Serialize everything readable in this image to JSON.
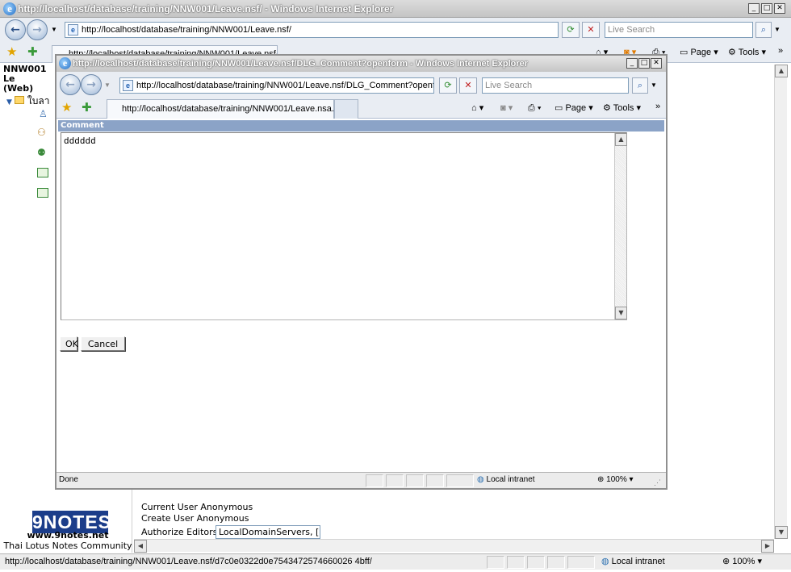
{
  "main_window": {
    "title": "http://localhost/database/training/NNW001/Leave.nsf/ - Windows Internet Explorer",
    "address": "http://localhost/database/training/NNW001/Leave.nsf/",
    "search_placeholder": "Live Search",
    "partial_tab": "http://localhost/database/training/NNW001/Leave.nsf/",
    "toolbar": {
      "page_label": "Page",
      "tools_label": "Tools"
    }
  },
  "background_page": {
    "header": "NNW001 Le",
    "header2": "(Web)",
    "tree_label": "ใบลา",
    "logo": {
      "brand": "9NOTES",
      "url": "www.9notes.net",
      "community": "Thai Lotus Notes Community"
    },
    "current_user": "Current User Anonymous",
    "create_user": "Create User Anonymous",
    "authorize_label": "Authorize Editors",
    "authorize_value": "LocalDomainServers, [",
    "status_url": "http://localhost/database/training/NNW001/Leave.nsf/d7c0e0322d0e7543472574660026 4bff/",
    "zone": "Local intranet",
    "zoom": "100%"
  },
  "dialog": {
    "title": "http://localhost/database/training/NNW001/Leave.nsf/DLG_Comment?openform - Windows Internet Explorer",
    "address": "http://localhost/database/training/NNW001/Leave.nsf/DLG_Comment?openfo",
    "search_placeholder": "Live Search",
    "tab_title": "http://localhost/database/training/NNW001/Leave.nsa...",
    "toolbar": {
      "page_label": "Page",
      "tools_label": "Tools"
    },
    "form": {
      "section_header": "Comment",
      "comment_value": "dddddd",
      "ok_label": "OK",
      "cancel_label": "Cancel"
    },
    "status_text": "Done",
    "zone": "Local intranet",
    "zoom": "100%"
  }
}
